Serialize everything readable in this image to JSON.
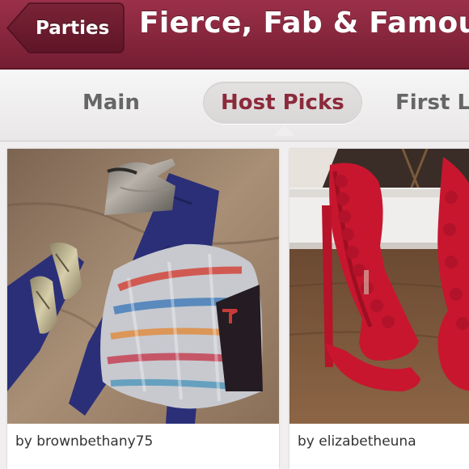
{
  "header": {
    "back_label": "Parties",
    "title": "Fierce, Fab & Famous"
  },
  "tabs": [
    {
      "label": "Main",
      "selected": false
    },
    {
      "label": "Host Picks",
      "selected": true
    },
    {
      "label": "First Look",
      "selected": false
    }
  ],
  "listings": [
    {
      "seller": "by brownbethany75",
      "image": "outfit-photo"
    },
    {
      "seller": "by elizabetheuna",
      "image": "red-heels-photo"
    }
  ],
  "colors": {
    "brand": "#86263c",
    "selected_tab_text": "#8b2a3b"
  }
}
